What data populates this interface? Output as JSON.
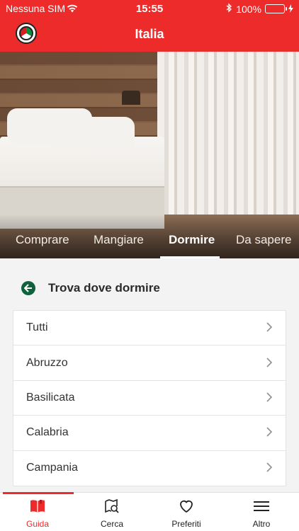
{
  "status_bar": {
    "carrier": "Nessuna SIM",
    "time": "15:55",
    "battery": "100%"
  },
  "header": {
    "title": "Italia",
    "logo_icon": "italy-flag-logo-icon"
  },
  "hero": {
    "image": "bedroom-photo",
    "tabs": [
      {
        "label": "Comprare",
        "active": false
      },
      {
        "label": "Mangiare",
        "active": false
      },
      {
        "label": "Dormire",
        "active": true
      },
      {
        "label": "Da sapere",
        "active": false
      }
    ]
  },
  "section": {
    "back_icon": "back-arrow-icon",
    "title": "Trova dove dormire"
  },
  "regions": [
    {
      "label": "Tutti"
    },
    {
      "label": "Abruzzo"
    },
    {
      "label": "Basilicata"
    },
    {
      "label": "Calabria"
    },
    {
      "label": "Campania"
    }
  ],
  "tabbar": {
    "items": [
      {
        "label": "Guida",
        "icon": "book-icon",
        "active": true
      },
      {
        "label": "Cerca",
        "icon": "search-map-icon",
        "active": false
      },
      {
        "label": "Preferiti",
        "icon": "heart-icon",
        "active": false
      },
      {
        "label": "Altro",
        "icon": "menu-icon",
        "active": false
      }
    ]
  },
  "colors": {
    "brand_red": "#ee2b2b",
    "accent_green": "#11613c"
  }
}
